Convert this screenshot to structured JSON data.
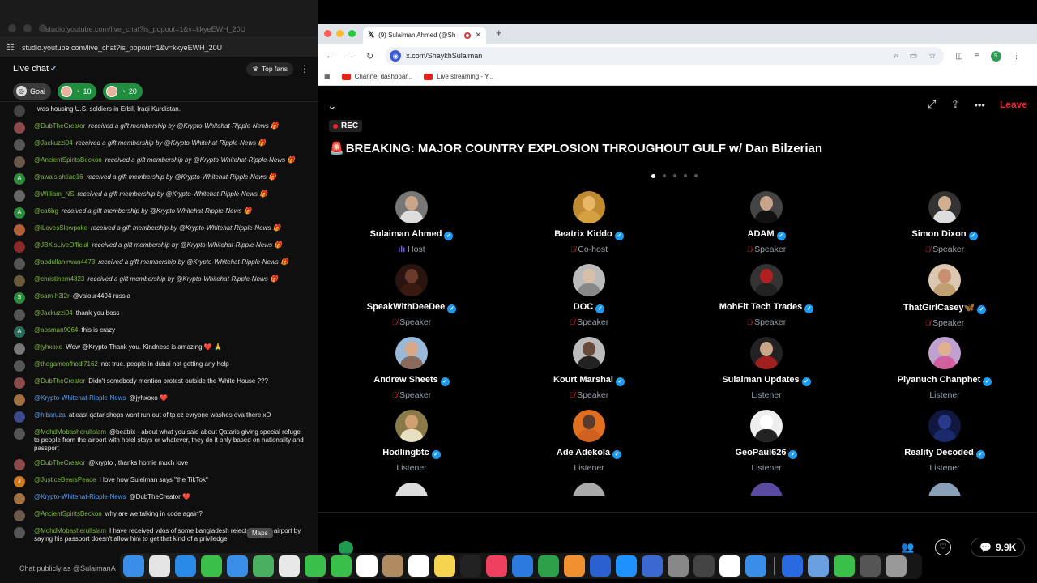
{
  "youtube": {
    "window_title": "studio.youtube.com/live_chat?is_popout=1&v=kkyeEWH_20U",
    "url": "studio.youtube.com/live_chat?is_popout=1&v=kkyeEWH_20U",
    "header": {
      "title": "Live chat",
      "top_fans": "Top fans"
    },
    "goals": {
      "goal_label": "Goal",
      "goal_a_count": "10",
      "goal_b_count": "20"
    },
    "messages": [
      {
        "author": "",
        "text": "was housing U.S. soldiers in Erbil, Iraqi Kurdistan.",
        "avatar": "",
        "color": "#444"
      },
      {
        "author": "@DubTheCreator",
        "text": "received a gift membership by @Krypto-Whitehat-Ripple-News 🎁",
        "avatar": "",
        "color": "#8a4a4a",
        "gift": true
      },
      {
        "author": "@Jackuzzi04",
        "text": "received a gift membership by @Krypto-Whitehat-Ripple-News 🎁",
        "avatar": "",
        "color": "#555",
        "gift": true
      },
      {
        "author": "@AncientSpiritsBeckon",
        "text": "received a gift membership by @Krypto-Whitehat-Ripple-News 🎁",
        "avatar": "",
        "color": "#6b5a4a",
        "gift": true
      },
      {
        "author": "@awaisishtiaq16",
        "text": "received a gift membership by @Krypto-Whitehat-Ripple-News 🎁",
        "avatar": "A",
        "color": "#2e8b3e",
        "gift": true
      },
      {
        "author": "@William_NS",
        "text": "received a gift membership by @Krypto-Whitehat-Ripple-News 🎁",
        "avatar": "",
        "color": "#666",
        "gift": true
      },
      {
        "author": "@ca6bg",
        "text": "received a gift membership by @Krypto-Whitehat-Ripple-News 🎁",
        "avatar": "A",
        "color": "#2e8b3e",
        "gift": true
      },
      {
        "author": "@iLovesSlowpoke",
        "text": "received a gift membership by @Krypto-Whitehat-Ripple-News 🎁",
        "avatar": "",
        "color": "#b0603a",
        "gift": true
      },
      {
        "author": "@JBXisLiveOfficial",
        "text": "received a gift membership by @Krypto-Whitehat-Ripple-News 🎁",
        "avatar": "",
        "color": "#8a2a2a",
        "gift": true
      },
      {
        "author": "@abdullahirwan4473",
        "text": "received a gift membership by @Krypto-Whitehat-Ripple-News 🎁",
        "avatar": "",
        "color": "#555",
        "gift": true
      },
      {
        "author": "@christinem4323",
        "text": "received a gift membership by @Krypto-Whitehat-Ripple-News 🎁",
        "avatar": "",
        "color": "#6a5a3a",
        "gift": true
      },
      {
        "author": "@sam-h3l2r",
        "text": "@valour4494 russia",
        "avatar": "S",
        "color": "#2e8b3e"
      },
      {
        "author": "@Jackuzzi04",
        "text": "thank you boss",
        "avatar": "",
        "color": "#555"
      },
      {
        "author": "@aosman9064",
        "text": "this is crazy",
        "avatar": "A",
        "color": "#2a6a5a"
      },
      {
        "author": "@jyhxoxo",
        "text": "Wow @Krypto Thank you. Kindness is amazing ❤️ 🙏",
        "avatar": "",
        "color": "#777"
      },
      {
        "author": "@thegameofhodl7162",
        "text": "not true. people in dubai not getting any help",
        "avatar": "",
        "color": "#555"
      },
      {
        "author": "@DubTheCreator",
        "text": "Didn't somebody mention protest outside the White House ???",
        "avatar": "",
        "color": "#8a4a4a"
      },
      {
        "author": "@Krypto-Whitehat-Ripple-News",
        "text": "@jyhxoxo ❤️",
        "avatar": "",
        "color": "#a07040"
      },
      {
        "author": "@hibaruza",
        "text": "atleast qatar shops wont run out of tp cz evryone washes ova there xD",
        "avatar": "",
        "color": "#3a4a8a"
      },
      {
        "author": "@MohdMobasherulIslam",
        "text": "@beatrix - about what you said about Qataris giving special refuge to people from the airport with hotel stays or whatever, they do it only based on nationality and passport",
        "avatar": "",
        "color": "#555"
      },
      {
        "author": "@DubTheCreator",
        "text": "@krypto , thanks homie much love",
        "avatar": "",
        "color": "#8a4a4a"
      },
      {
        "author": "@JusticeBearsPeace",
        "text": "I love how Suleiman says \"the TikTok\"",
        "avatar": "J",
        "color": "#d07a20"
      },
      {
        "author": "@Krypto-Whitehat-Ripple-News",
        "text": "@DubTheCreator ❤️",
        "avatar": "",
        "color": "#a07040"
      },
      {
        "author": "@AncientSpiritsBeckon",
        "text": "why are we talking in code again?",
        "avatar": "",
        "color": "#6b5a4a"
      },
      {
        "author": "@MohdMobasherulIslam",
        "text": "I have received vdos of some bangladesh rejected at the airport by saying his passport doesn't allow him to get that kind of a priviledge",
        "avatar": "",
        "color": "#555"
      }
    ],
    "composer_placeholder": "Chat publicly as @SulaimanA"
  },
  "chrome": {
    "tab_title": "(9) Sulaiman Ahmed (@Sh",
    "url": "x.com/ShaykhSulaiman",
    "bookmarks": [
      "Channel dashboar...",
      "Live streaming - Y..."
    ]
  },
  "space": {
    "leave_label": "Leave",
    "rec_label": "REC",
    "title": "BREAKING: MAJOR COUNTRY EXPLOSION THROUGHOUT GULF w/ Dan Bilzerian",
    "listener_count": "9.9K",
    "participants": [
      {
        "name": "Sulaiman Ahmed",
        "role": "Host",
        "skin": "#c9a58a",
        "shirt": "#ddd",
        "bg": "#777"
      },
      {
        "name": "Beatrix Kiddo",
        "role": "Co-host",
        "skin": "#e8b866",
        "shirt": "#d4a040",
        "bg": "#c08a30"
      },
      {
        "name": "ADAM",
        "role": "Speaker",
        "skin": "#c8a58a",
        "shirt": "#111",
        "bg": "#444"
      },
      {
        "name": "Simon Dixon",
        "role": "Speaker",
        "skin": "#d0b090",
        "shirt": "#ddd",
        "bg": "#333"
      },
      {
        "name": "SpeakWithDeeDee",
        "role": "Speaker",
        "skin": "#6a3a2a",
        "shirt": "#3a1a10",
        "bg": "#2a1410"
      },
      {
        "name": "DOC",
        "role": "Speaker",
        "skin": "#d8c0a8",
        "shirt": "#888",
        "bg": "#bbb"
      },
      {
        "name": "MohFit Tech Trades",
        "role": "Speaker",
        "skin": "#b02020",
        "shirt": "#222",
        "bg": "#333"
      },
      {
        "name": "ThatGirlCasey🦋",
        "role": "Speaker",
        "skin": "#c89070",
        "shirt": "#c0a070",
        "bg": "#dcc8b0"
      },
      {
        "name": "Andrew Sheets",
        "role": "Speaker",
        "skin": "#d8a888",
        "shirt": "#8a6a5a",
        "bg": "#9ab8d8"
      },
      {
        "name": "Kourt Marshal",
        "role": "Speaker",
        "skin": "#6a4a3a",
        "shirt": "#222",
        "bg": "#bbb"
      },
      {
        "name": "Sulaiman Updates",
        "role": "Listener",
        "skin": "#c9a58a",
        "shirt": "#a02020",
        "bg": "#222"
      },
      {
        "name": "Piyanuch Chanphet",
        "role": "Listener",
        "skin": "#e0b090",
        "shirt": "#d060a0",
        "bg": "#c0a0d0"
      },
      {
        "name": "Hodlingbtc",
        "role": "Listener",
        "skin": "#d0a070",
        "shirt": "#e8e0c0",
        "bg": "#8a7a4a"
      },
      {
        "name": "Ade Adekola",
        "role": "Listener",
        "skin": "#5a3a2a",
        "shirt": "#d06020",
        "bg": "#e07020"
      },
      {
        "name": "GeoPaul626",
        "role": "Listener",
        "skin": "#fff",
        "shirt": "#222",
        "bg": "#eee"
      },
      {
        "name": "Reality Decoded",
        "role": "Listener",
        "skin": "#2a3a8a",
        "shirt": "#1a2a6a",
        "bg": "#101840"
      }
    ]
  },
  "dock": [
    "Finder",
    "Launchpad",
    "Safari",
    "Messages",
    "Mail",
    "Maps",
    "Photos",
    "FaceTime",
    "Phone",
    "Calendar",
    "Contacts",
    "Reminders",
    "Notes",
    "TV",
    "Music",
    "Keynote",
    "Numbers",
    "Pages",
    "Testflight",
    "App Store",
    "Preview",
    "System Settings",
    "Activity",
    "Chrome",
    "Safari Tech",
    "Finder2",
    "QuickTime",
    "WhatsApp",
    "Photos2",
    "Trash"
  ],
  "dock_tooltip": "Maps",
  "colors": {
    "accent_red": "#f4212e",
    "verified_blue": "#1d9bf0",
    "yt_green": "#7fba3f"
  }
}
